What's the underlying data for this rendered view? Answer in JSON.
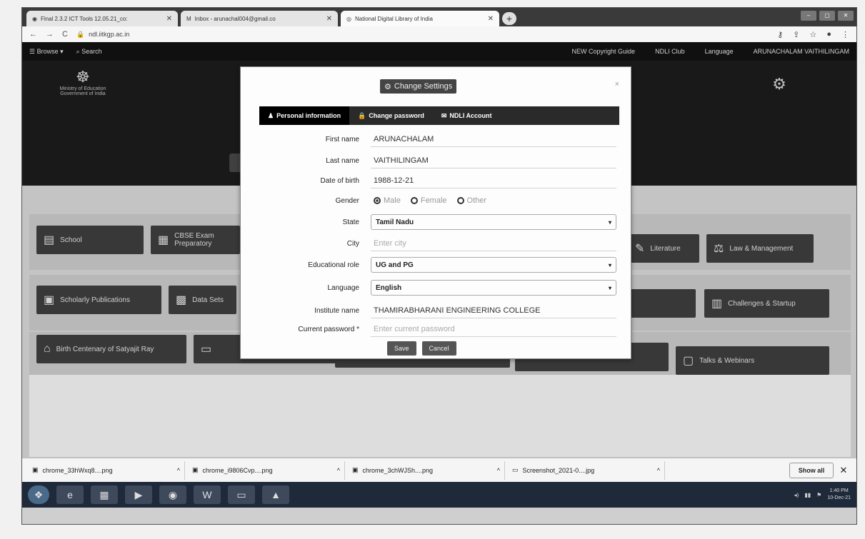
{
  "browser": {
    "tabs": [
      {
        "title": "Final 2.3.2 ICT Tools 12.05.21_co:"
      },
      {
        "title": "Inbox - arunachal004@gmail.co"
      },
      {
        "title": "National Digital Library of India"
      }
    ],
    "url": "ndl.iitkgp.ac.in"
  },
  "site": {
    "nav_left": [
      "Browse",
      "Search"
    ],
    "nav_right": [
      "NEW Copyright Guide",
      "NDLI Club",
      "Language",
      "ARUNACHALAM VAITHILINGAM"
    ],
    "ministry": "Ministry of Education Government of India"
  },
  "tiles": {
    "row1": [
      "School",
      "CBSE Exam Preparatory",
      "Literature",
      "Law & Management"
    ],
    "row2": [
      "Scholarly Publications",
      "Data Sets",
      "Challenges & Startup"
    ],
    "row3": [
      "Birth Centenary of Satyajit Ray",
      "Talks & Webinars"
    ]
  },
  "modal": {
    "title": "Change Settings",
    "tabs": [
      "Personal information",
      "Change password",
      "NDLI Account"
    ],
    "first_name_label": "First name",
    "first_name": "ARUNACHALAM",
    "last_name_label": "Last name",
    "last_name": "VAITHILINGAM",
    "dob_label": "Date of birth",
    "dob": "1988-12-21",
    "gender_label": "Gender",
    "gender_options": [
      "Male",
      "Female",
      "Other"
    ],
    "state_label": "State",
    "state": "Tamil Nadu",
    "city_label": "City",
    "city_placeholder": "Enter city",
    "edu_role_label": "Educational role",
    "edu_role": "UG and PG",
    "language_label": "Language",
    "language": "English",
    "institute_label": "Institute name",
    "institute": "THAMIRABHARANI ENGINEERING COLLEGE",
    "password_label": "Current password *",
    "password_placeholder": "Enter current password",
    "save": "Save",
    "cancel": "Cancel"
  },
  "downloads": {
    "items": [
      "chrome_33hWxq8....png",
      "chrome_i9806Cvp....png",
      "chrome_3chWJSh....png",
      "Screenshot_2021-0....jpg"
    ],
    "show_all": "Show all"
  },
  "taskbar": {
    "time": "1:40 PM",
    "date": "10-Dec-21"
  }
}
